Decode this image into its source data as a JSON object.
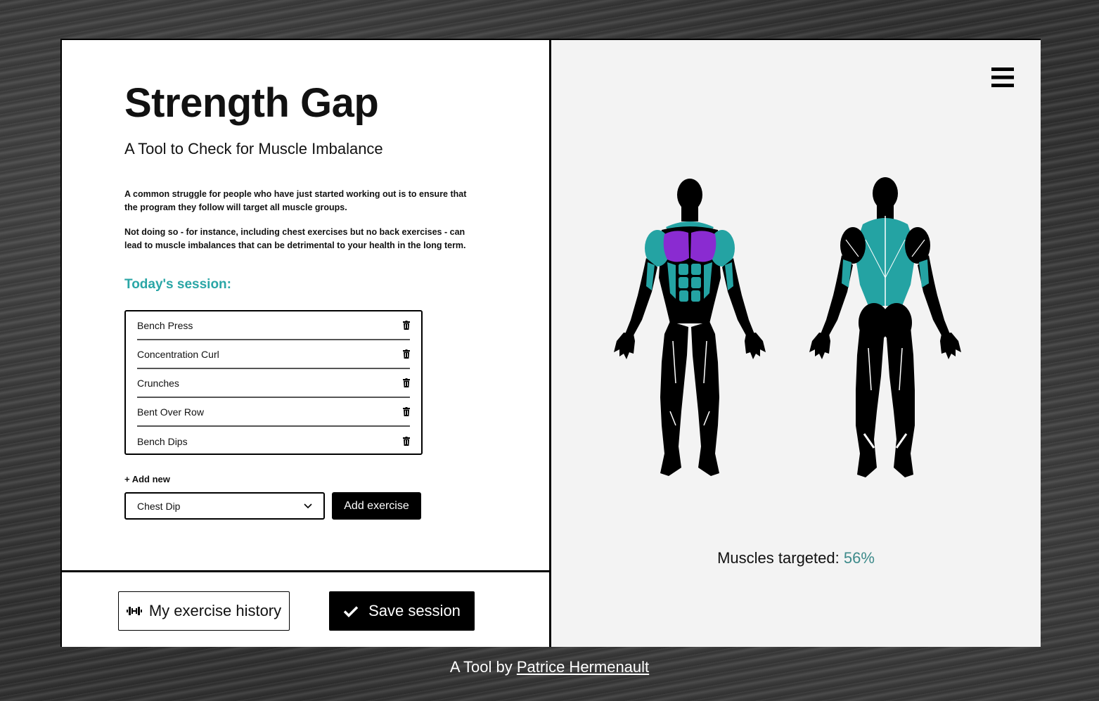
{
  "header": {
    "title": "Strength Gap",
    "subtitle": "A Tool to Check for Muscle Imbalance"
  },
  "intro": {
    "paragraph1": "A common struggle for people who have just started working out is to ensure that the program they follow will target all muscle groups.",
    "paragraph2": "Not doing so - for instance, including chest exercises but no back exercises - can lead to muscle imbalances that can be detrimental to your health in the long term."
  },
  "session": {
    "title": "Today's session:",
    "exercises": [
      "Bench Press",
      "Concentration Curl",
      "Crunches",
      "Bent Over Row",
      "Bench Dips"
    ]
  },
  "add": {
    "label": "+ Add new",
    "selected": "Chest Dip",
    "button": "Add exercise"
  },
  "actions": {
    "history": "My exercise history",
    "save": "Save session"
  },
  "stats": {
    "label": "Muscles targeted:",
    "percent": "56%"
  },
  "footer": {
    "prefix": "A Tool by",
    "author": "Patrice Hermenault"
  },
  "colors": {
    "accent": "#2aa6a6",
    "chest_highlight": "#8a2bd1",
    "muscle_secondary": "#24a3a3",
    "percent": "#3d8a8a"
  },
  "icons": [
    "menu-icon",
    "trash-icon",
    "dumbbell-icon",
    "check-icon",
    "chevron-down-icon"
  ]
}
